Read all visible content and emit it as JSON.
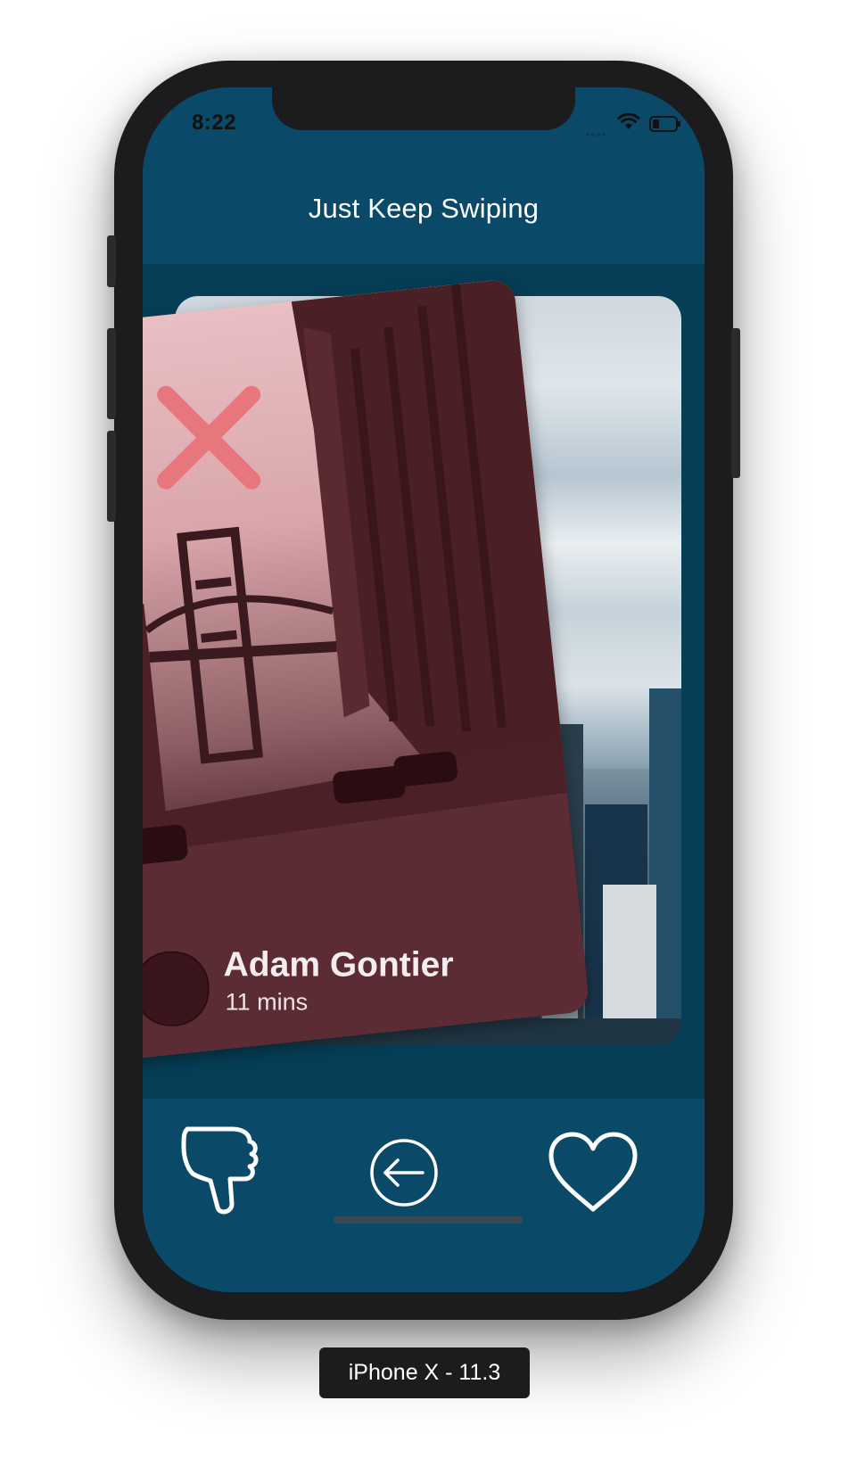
{
  "status_bar": {
    "time": "8:22"
  },
  "nav": {
    "title": "Just Keep Swiping"
  },
  "front_card": {
    "name": "Adam Gontier",
    "subtitle": "11 mins",
    "overlay_icon": "x-icon",
    "overlay_color": "#e8767d"
  },
  "actions": {
    "dislike_icon": "thumbs-down-icon",
    "undo_icon": "back-arrow-circle-icon",
    "like_icon": "heart-icon"
  },
  "device_label": "iPhone X - 11.3",
  "colors": {
    "nav_bg": "#0a4a68",
    "card_area_bg": "#063e56",
    "device_frame": "#1c1c1e",
    "icon_stroke": "#ffffff"
  }
}
